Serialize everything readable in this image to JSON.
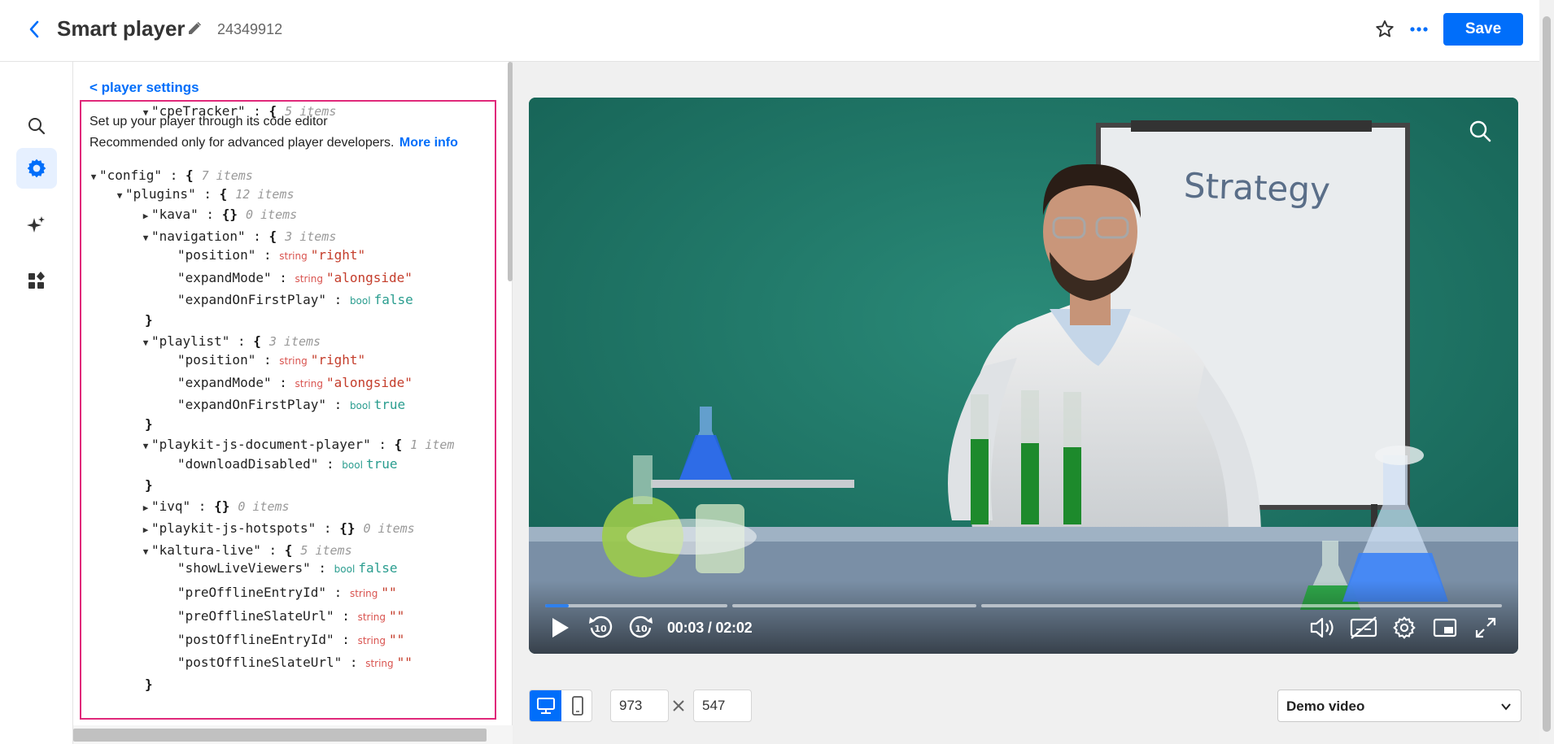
{
  "header": {
    "title": "Smart player",
    "entry_id": "24349912",
    "save_label": "Save"
  },
  "rail": {
    "items": [
      "search",
      "settings",
      "ai",
      "plugins"
    ],
    "active": "settings"
  },
  "panel": {
    "back_link": "< player settings",
    "desc_line1": "Set up your player through its code editor",
    "desc_line2": "Recommended only for advanced player developers.",
    "more_info": "More info",
    "code": [
      {
        "indent": 0,
        "caret": "open",
        "key": "\"config\"",
        "brace": "{",
        "count": "7 items"
      },
      {
        "indent": 1,
        "caret": "open",
        "key": "\"plugins\"",
        "brace": "{",
        "count": "12 items"
      },
      {
        "indent": 2,
        "caret": "closed",
        "key": "\"kava\"",
        "brace": "{}",
        "count": "0 items"
      },
      {
        "indent": 2,
        "caret": "open",
        "key": "\"navigation\"",
        "brace": "{",
        "count": "3 items"
      },
      {
        "indent": 3,
        "key": "\"position\"",
        "type": "string",
        "value": "\"right\""
      },
      {
        "indent": 3,
        "key": "\"expandMode\"",
        "type": "string",
        "value": "\"alongside\""
      },
      {
        "indent": 3,
        "key": "\"expandOnFirstPlay\"",
        "type": "bool",
        "value": "false"
      },
      {
        "indent": 2,
        "close": "}"
      },
      {
        "indent": 2,
        "caret": "open",
        "key": "\"playlist\"",
        "brace": "{",
        "count": "3 items"
      },
      {
        "indent": 3,
        "key": "\"position\"",
        "type": "string",
        "value": "\"right\""
      },
      {
        "indent": 3,
        "key": "\"expandMode\"",
        "type": "string",
        "value": "\"alongside\""
      },
      {
        "indent": 3,
        "key": "\"expandOnFirstPlay\"",
        "type": "bool",
        "value": "true"
      },
      {
        "indent": 2,
        "close": "}"
      },
      {
        "indent": 2,
        "caret": "open",
        "key": "\"playkit-js-document-player\"",
        "brace": "{",
        "count": "1 item"
      },
      {
        "indent": 3,
        "key": "\"downloadDisabled\"",
        "type": "bool",
        "value": "true"
      },
      {
        "indent": 2,
        "close": "}"
      },
      {
        "indent": 2,
        "caret": "closed",
        "key": "\"ivq\"",
        "brace": "{}",
        "count": "0 items"
      },
      {
        "indent": 2,
        "caret": "closed",
        "key": "\"playkit-js-hotspots\"",
        "brace": "{}",
        "count": "0 items"
      },
      {
        "indent": 2,
        "caret": "open",
        "key": "\"kaltura-live\"",
        "brace": "{",
        "count": "5 items"
      },
      {
        "indent": 3,
        "key": "\"showLiveViewers\"",
        "type": "bool",
        "value": "false"
      },
      {
        "indent": 3,
        "key": "\"preOfflineEntryId\"",
        "type": "string",
        "value": "\"\""
      },
      {
        "indent": 3,
        "key": "\"preOfflineSlateUrl\"",
        "type": "string",
        "value": "\"\""
      },
      {
        "indent": 3,
        "key": "\"postOfflineEntryId\"",
        "type": "string",
        "value": "\"\""
      },
      {
        "indent": 3,
        "key": "\"postOfflineSlateUrl\"",
        "type": "string",
        "value": "\"\""
      },
      {
        "indent": 2,
        "close": "}"
      },
      {
        "indent": 2,
        "caret": "open",
        "key": "\"cpeTracker\"",
        "brace": "{",
        "count": "5 items"
      }
    ]
  },
  "video": {
    "whiteboard_text": "Strategy",
    "time": "00:03 / 02:02",
    "progress_fraction": 0.025
  },
  "toolbar": {
    "width": "973",
    "height": "547",
    "media_select": "Demo video"
  },
  "colors": {
    "accent": "#006efa",
    "highlight_border": "#e0287a"
  }
}
